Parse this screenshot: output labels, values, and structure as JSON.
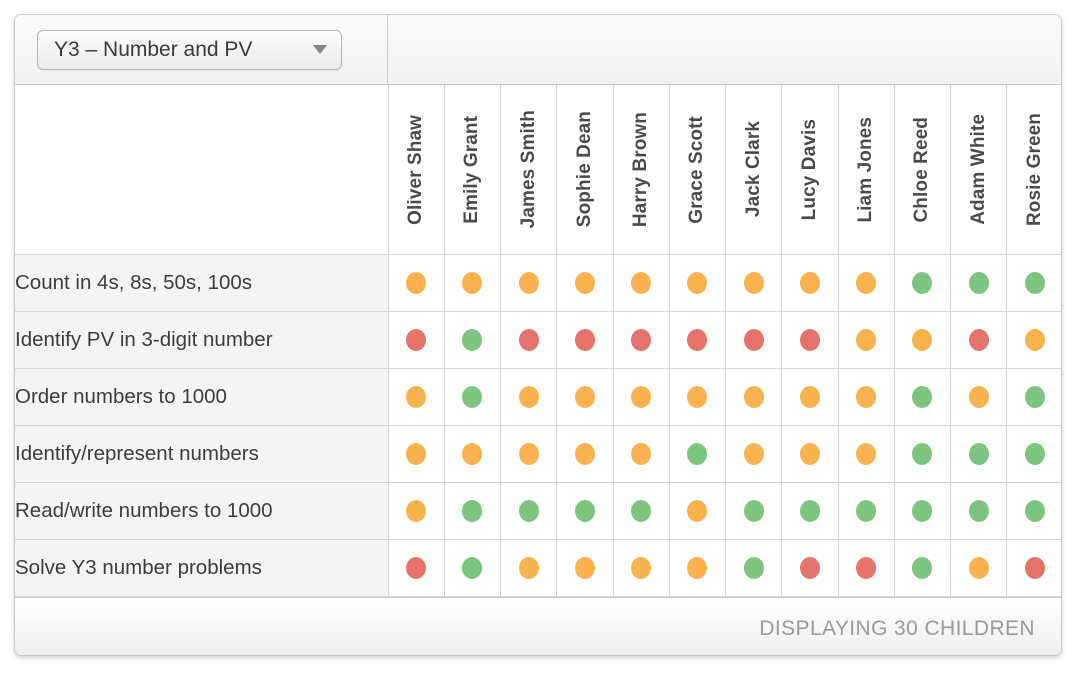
{
  "toolbar": {
    "class_select_value": "Y3 – Number and PV",
    "caret_icon": "chevron-down-icon"
  },
  "table": {
    "pupils": [
      "Oliver Shaw",
      "Emily Grant",
      "James Smith",
      "Sophie Dean",
      "Harry Brown",
      "Grace Scott",
      "Jack Clark",
      "Lucy Davis",
      "Liam Jones",
      "Chloe Reed",
      "Adam White",
      "Rosie Green"
    ],
    "objectives": [
      "Count in 4s, 8s, 50s, 100s",
      "Identify PV in 3-digit number",
      "Order numbers to 1000",
      "Identify/represent numbers",
      "Read/write numbers to 1000",
      "Solve Y3 number problems"
    ],
    "statuses": [
      [
        "a",
        "a",
        "a",
        "a",
        "a",
        "a",
        "a",
        "a",
        "a",
        "g",
        "g",
        "g"
      ],
      [
        "r",
        "g",
        "r",
        "r",
        "r",
        "r",
        "r",
        "r",
        "a",
        "a",
        "r",
        "a"
      ],
      [
        "a",
        "g",
        "a",
        "a",
        "a",
        "a",
        "a",
        "a",
        "a",
        "g",
        "a",
        "g"
      ],
      [
        "a",
        "a",
        "a",
        "a",
        "a",
        "g",
        "a",
        "a",
        "a",
        "g",
        "g",
        "g"
      ],
      [
        "a",
        "g",
        "g",
        "g",
        "g",
        "a",
        "g",
        "g",
        "g",
        "g",
        "g",
        "g"
      ],
      [
        "r",
        "g",
        "a",
        "a",
        "a",
        "a",
        "g",
        "r",
        "r",
        "g",
        "a",
        "r"
      ]
    ],
    "status_colors": {
      "g": "#7cc47f",
      "a": "#f9b24d",
      "r": "#e5736c"
    }
  },
  "footer": {
    "displaying_text": "DISPLAYING 30 CHILDREN"
  }
}
